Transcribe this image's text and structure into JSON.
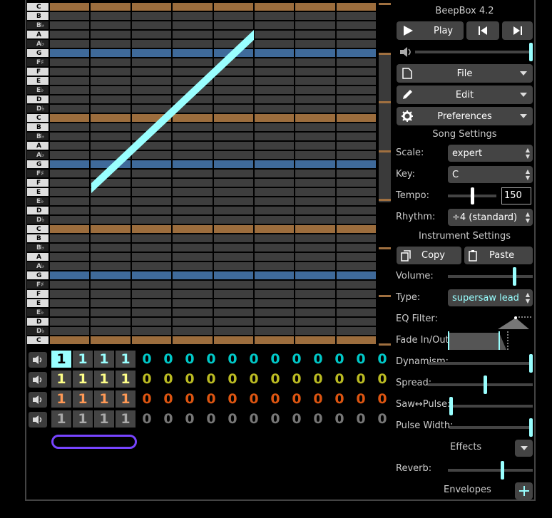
{
  "app_title": "BeepBox 4.2",
  "colors": {
    "accent": "#99ffff",
    "octave_row": "#9c6d3d",
    "tonic_row": "#3f6a9a",
    "cell": "#3e3e3e",
    "note": "#99ffff",
    "loop": "#7744ff"
  },
  "piano_keys": [
    "C",
    "B",
    "B♭",
    "A",
    "A♭",
    "G",
    "F♯",
    "F",
    "E",
    "E♭",
    "D",
    "D♭",
    "C",
    "B",
    "B♭",
    "A",
    "A♭",
    "G",
    "F♯",
    "F",
    "E",
    "E♭",
    "D",
    "D♭",
    "C",
    "B",
    "B♭",
    "A",
    "A♭",
    "G",
    "F♯",
    "F",
    "E",
    "E♭",
    "D",
    "D♭",
    "C"
  ],
  "pattern_rows": [
    {
      "channel": "pitch-1",
      "color": "#00c8c8",
      "selected_color": "#99ffff",
      "values": [
        "1",
        "1",
        "1",
        "1",
        "0",
        "0",
        "0",
        "0",
        "0",
        "0",
        "0",
        "0",
        "0",
        "0",
        "0",
        "0"
      ]
    },
    {
      "channel": "pitch-2",
      "color": "#bbbb22",
      "selected_color": "#ffff88",
      "values": [
        "1",
        "1",
        "1",
        "1",
        "0",
        "0",
        "0",
        "0",
        "0",
        "0",
        "0",
        "0",
        "0",
        "0",
        "0",
        "0"
      ]
    },
    {
      "channel": "pitch-3",
      "color": "#dd5511",
      "selected_color": "#ff9955",
      "values": [
        "1",
        "1",
        "1",
        "1",
        "0",
        "0",
        "0",
        "0",
        "0",
        "0",
        "0",
        "0",
        "0",
        "0",
        "0",
        "0"
      ]
    },
    {
      "channel": "drum",
      "color": "#777777",
      "selected_color": "#aaaaaa",
      "values": [
        "1",
        "1",
        "1",
        "1",
        "0",
        "0",
        "0",
        "0",
        "0",
        "0",
        "0",
        "0",
        "0",
        "0",
        "0",
        "0"
      ]
    }
  ],
  "transport": {
    "play_label": "Play"
  },
  "menus": {
    "file": "File",
    "edit": "Edit",
    "preferences": "Preferences"
  },
  "song_settings": {
    "header": "Song Settings",
    "scale_label": "Scale:",
    "scale_value": "expert",
    "key_label": "Key:",
    "key_value": "C",
    "tempo_label": "Tempo:",
    "tempo_value": "150",
    "rhythm_label": "Rhythm:",
    "rhythm_value": "÷4 (standard)"
  },
  "instrument_settings": {
    "header": "Instrument Settings",
    "copy": "Copy",
    "paste": "Paste",
    "volume_label": "Volume:",
    "type_label": "Type:",
    "type_value": "supersaw lead",
    "eq_label": "EQ Filter:",
    "fade_label": "Fade In/Out:",
    "dynamism_label": "Dynamism:",
    "spread_label": "Spread:",
    "saw_pulse_label": "Saw↔Pulse:",
    "pulse_width_label": "Pulse Width:",
    "effects_label": "Effects",
    "reverb_label": "Reverb:",
    "envelopes_label": "Envelopes"
  },
  "slider_levels": {
    "master_volume": 1.0,
    "volume": 0.8,
    "dynamism": 1.0,
    "spread": 0.55,
    "saw_pulse": 0.0,
    "pulse_width": 1.0,
    "reverb": 0.65,
    "tempo": 0.5
  }
}
